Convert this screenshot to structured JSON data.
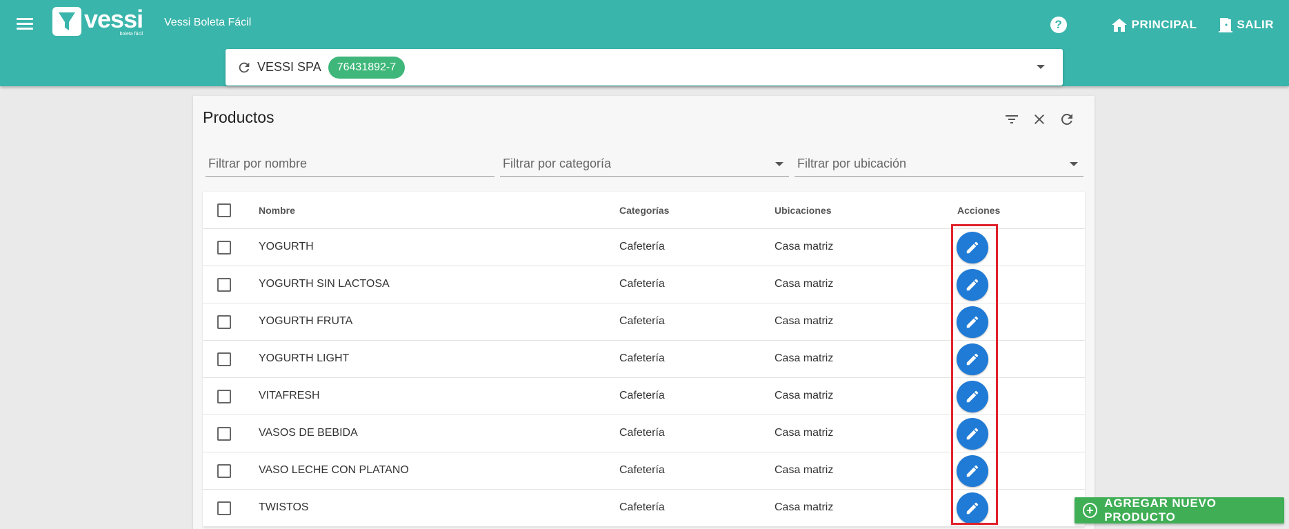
{
  "header": {
    "logo_text": "vessi",
    "logo_sub": "boleta fácil",
    "app_name": "Vessi Boleta Fácil",
    "help_label": "?",
    "principal_label": "PRINCIPAL",
    "salir_label": "SALIR",
    "bg_color": "#3ab5ab"
  },
  "company": {
    "name": "VESSI SPA",
    "rut": "76431892-7",
    "rut_color": "#3fb77a"
  },
  "products": {
    "title": "Productos",
    "filters": {
      "name_placeholder": "Filtrar por nombre",
      "category_placeholder": "Filtrar por categoría",
      "location_placeholder": "Filtrar por ubicación"
    },
    "columns": [
      "Nombre",
      "Categorías",
      "Ubicaciones",
      "Acciones"
    ],
    "rows": [
      {
        "name": "YOGURTH",
        "category": "Cafetería",
        "location": "Casa matriz"
      },
      {
        "name": "YOGURTH SIN LACTOSA",
        "category": "Cafetería",
        "location": "Casa matriz"
      },
      {
        "name": "YOGURTH FRUTA",
        "category": "Cafetería",
        "location": "Casa matriz"
      },
      {
        "name": "YOGURTH LIGHT",
        "category": "Cafetería",
        "location": "Casa matriz"
      },
      {
        "name": "VITAFRESH",
        "category": "Cafetería",
        "location": "Casa matriz"
      },
      {
        "name": "VASOS DE BEBIDA",
        "category": "Cafetería",
        "location": "Casa matriz"
      },
      {
        "name": "VASO LECHE CON PLATANO",
        "category": "Cafetería",
        "location": "Casa matriz"
      },
      {
        "name": "TWISTOS",
        "category": "Cafetería",
        "location": "Casa matriz"
      }
    ]
  },
  "add_button": {
    "label": "AGREGAR NUEVO PRODUCTO",
    "color": "#3fae55"
  },
  "icons": {
    "menu": "menu-icon",
    "help": "help-icon",
    "home": "home-icon",
    "exit": "exit-door-icon",
    "refresh": "refresh-icon",
    "filter": "filter-icon",
    "close": "close-icon",
    "edit": "pencil-icon",
    "add": "plus-circle-icon"
  },
  "highlight_color": "#e0222b"
}
